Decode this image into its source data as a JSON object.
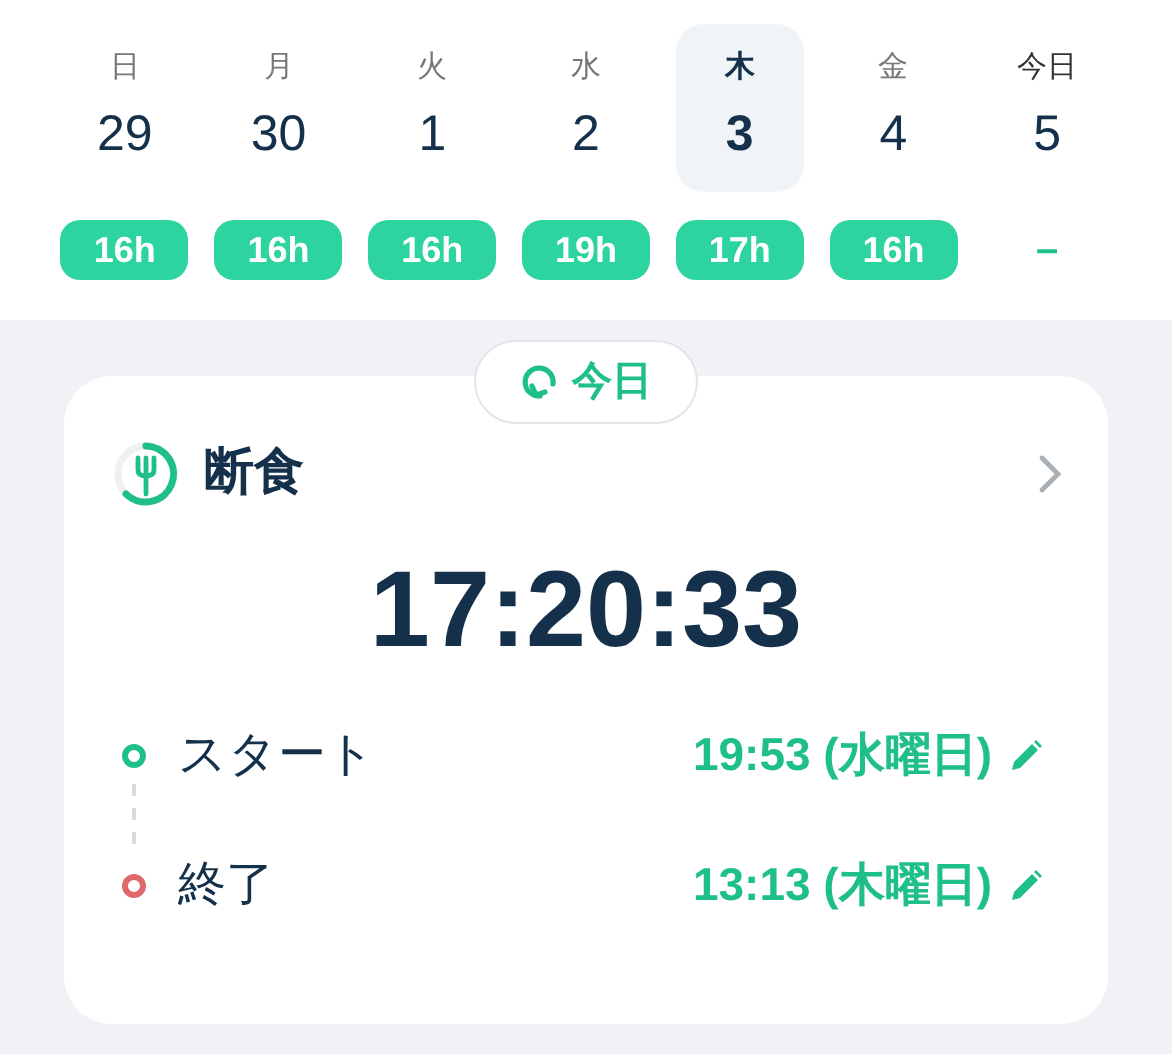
{
  "days": [
    {
      "weekday": "日",
      "date": "29",
      "fast": "16h",
      "badge": true,
      "selected": false
    },
    {
      "weekday": "月",
      "date": "30",
      "fast": "16h",
      "badge": true,
      "selected": false
    },
    {
      "weekday": "火",
      "date": "1",
      "fast": "16h",
      "badge": true,
      "selected": false
    },
    {
      "weekday": "水",
      "date": "2",
      "fast": "19h",
      "badge": true,
      "selected": false
    },
    {
      "weekday": "木",
      "date": "3",
      "fast": "17h",
      "badge": true,
      "selected": true
    },
    {
      "weekday": "金",
      "date": "4",
      "fast": "16h",
      "badge": true,
      "selected": false
    },
    {
      "weekday": "今日",
      "date": "5",
      "fast": "–",
      "badge": false,
      "selected": false
    }
  ],
  "today_button": {
    "label": "今日"
  },
  "card": {
    "title": "断食",
    "timer": "17:20:33",
    "events": [
      {
        "label": "スタート",
        "time": "19:53 (水曜日)",
        "color": "#1fbf8a"
      },
      {
        "label": "終了",
        "time": "13:13 (木曜日)",
        "color": "#e0686b"
      }
    ]
  }
}
